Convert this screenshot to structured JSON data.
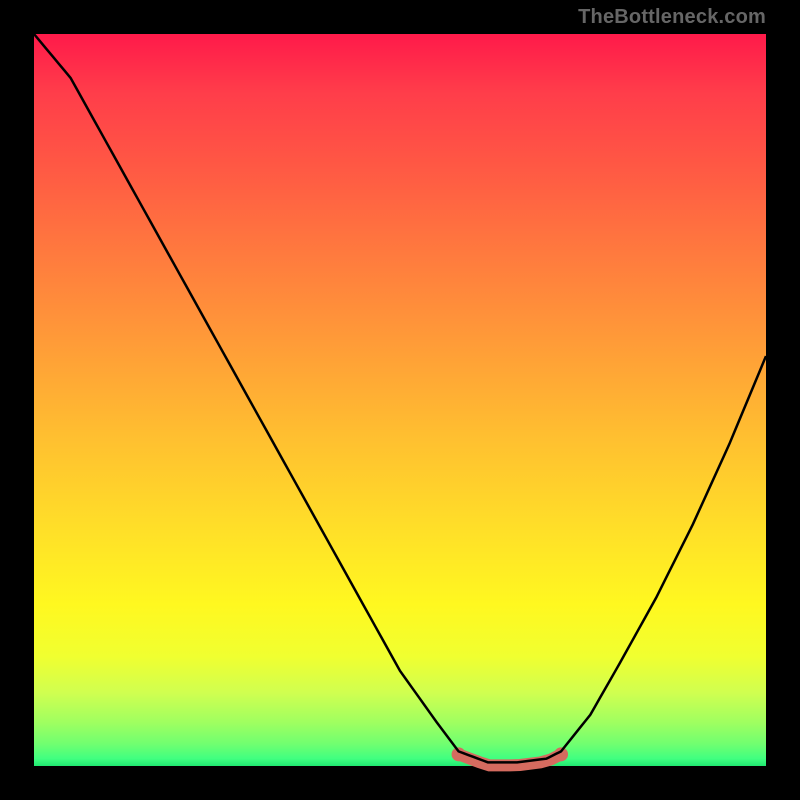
{
  "attribution": "TheBottleneck.com",
  "colors": {
    "background": "#000000",
    "curve": "#000000",
    "optimal_zone": "#d56b5f",
    "gradient_top": "#ff1a4a",
    "gradient_bottom": "#20e870"
  },
  "chart_data": {
    "type": "line",
    "title": "",
    "xlabel": "",
    "ylabel": "",
    "xlim": [
      0,
      100
    ],
    "ylim": [
      0,
      100
    ],
    "series": [
      {
        "name": "bottleneck-curve",
        "x": [
          0,
          5,
          10,
          15,
          20,
          25,
          30,
          35,
          40,
          45,
          50,
          55,
          58,
          62,
          66,
          70,
          72,
          76,
          80,
          85,
          90,
          95,
          100
        ],
        "y": [
          100,
          94,
          85,
          76,
          67,
          58,
          49,
          40,
          31,
          22,
          13,
          6,
          2,
          0.5,
          0.5,
          1,
          2,
          7,
          14,
          23,
          33,
          44,
          56
        ]
      }
    ],
    "optimal_zone": {
      "x_start": 58,
      "x_end": 72,
      "y_level": 1
    },
    "annotations": []
  }
}
